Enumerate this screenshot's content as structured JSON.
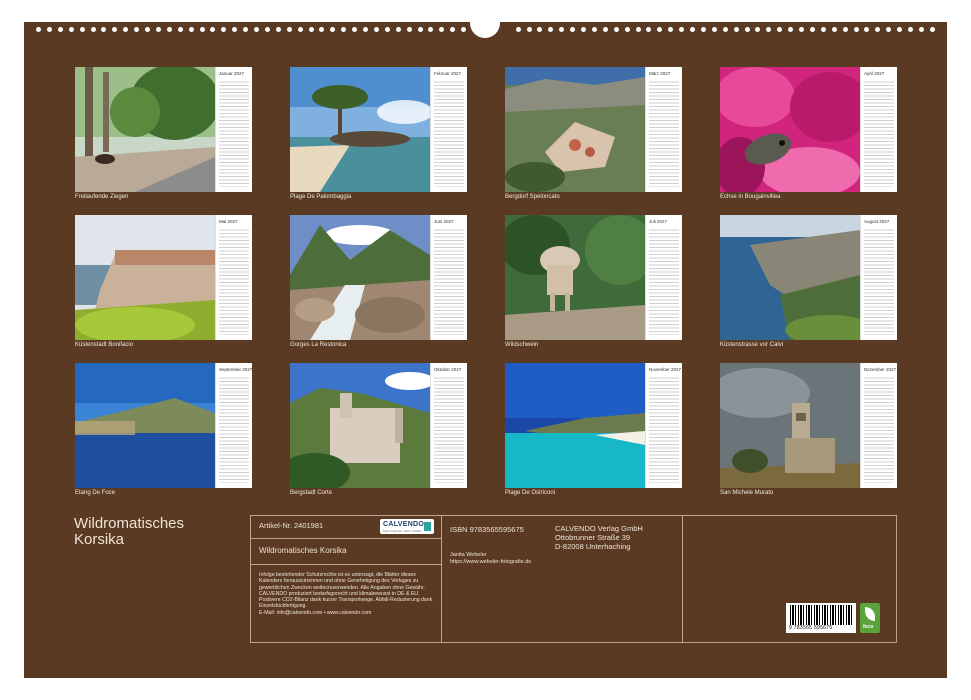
{
  "calendar": {
    "title_line1": "Wildromatisches",
    "title_line2": "Korsika",
    "months": [
      {
        "name": "Januar 2027",
        "caption": "Freilaufende Ziegen"
      },
      {
        "name": "Februar 2027",
        "caption": "Plage De Palombaggia"
      },
      {
        "name": "März 2027",
        "caption": "Bergdorf Speloncato"
      },
      {
        "name": "April 2027",
        "caption": "Echse in Bougainvillea"
      },
      {
        "name": "Mai 2027",
        "caption": "Küstenstadt Bonifacio"
      },
      {
        "name": "Juni 2027",
        "caption": "Gorges La Restonica"
      },
      {
        "name": "Juli 2027",
        "caption": "Wildschwein"
      },
      {
        "name": "August 2027",
        "caption": "Küstenstrasse vor Calvi"
      },
      {
        "name": "September 2027",
        "caption": "Etang De Foce"
      },
      {
        "name": "Oktober 2027",
        "caption": "Bergstadt Corte"
      },
      {
        "name": "November 2027",
        "caption": "Plage De Ostriconi"
      },
      {
        "name": "Dezember 2027",
        "caption": "San Michele Murato"
      }
    ]
  },
  "info": {
    "article": "Artikel-Nr. 2401981",
    "logo_name": "CALVENDO",
    "logo_tagline": "Mehr Kalender. Mehr Vielfalt.",
    "product_title": "Wildromatisches Korsika",
    "notice": "Infolge bestehender Schutzrechte ist es untersagt, die Blätter dieses Kalenders herauszutrennen und ohne Genehmigung des Verlages zu gewerblichen Zwecken weiterzuverwenden. Alle Angaben ohne Gewähr. CALVENDO produziert bedarfsgerecht und klimabewusst in DE & EU. Postivere CO2-Bilanz dank kurzer Transportwege. Abfall-Reduzierung dank Einzelstückfertigung.",
    "email": "E-Mail: info@calvendo.com • www.calvendo.com",
    "isbn": "ISBN 9783565595675",
    "publisher_name": "CALVENDO Verlag GmbH",
    "publisher_street": "Ottobrunner Straße 39",
    "publisher_city": "D-82008 Unterhaching",
    "author": "Janita Webeler",
    "author_url": "https://www.webeler-fotografie.de",
    "barcode_number": "9 783565 595675",
    "eco_label": "feco"
  },
  "colors": {
    "board": "#5a3a22",
    "text": "#efe4d6"
  }
}
